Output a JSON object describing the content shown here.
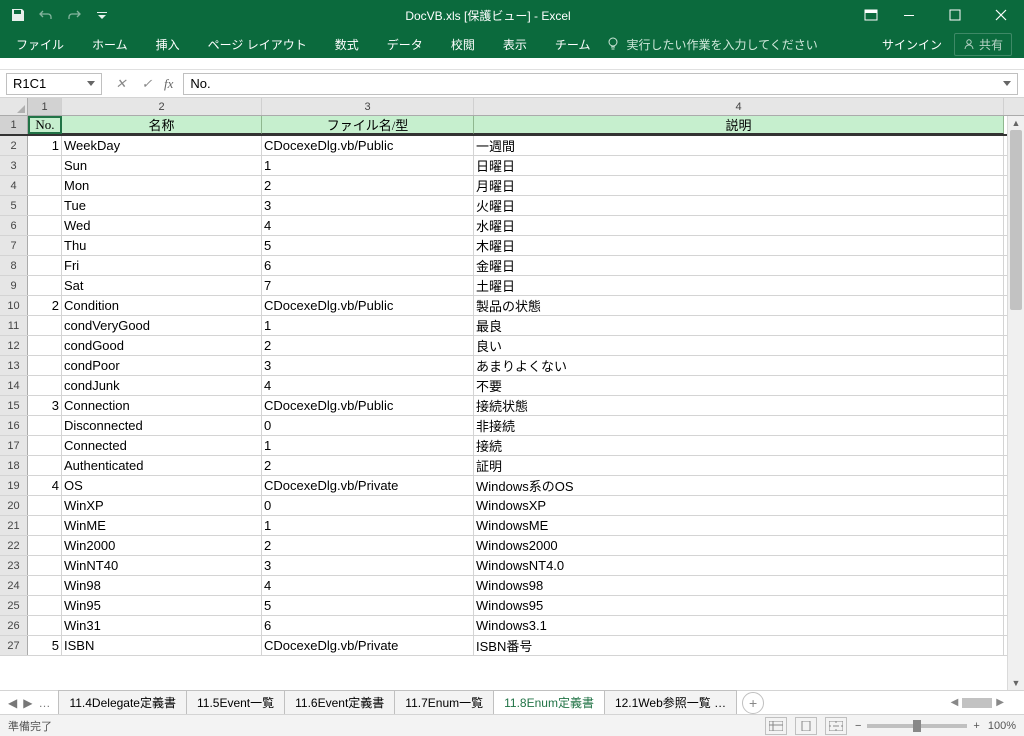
{
  "title": "DocVB.xls  [保護ビュー] - Excel",
  "ribbon_tabs": [
    "ファイル",
    "ホーム",
    "挿入",
    "ページ レイアウト",
    "数式",
    "データ",
    "校閲",
    "表示",
    "チーム"
  ],
  "tellme": "実行したい作業を入力してください",
  "signin": "サインイン",
  "share": "共有",
  "namebox": "R1C1",
  "formula": "No.",
  "col_headers": [
    "1",
    "2",
    "3",
    "4"
  ],
  "table_headers": [
    "No.",
    "名称",
    "ファイル名/型",
    "説明"
  ],
  "rows": [
    {
      "n": "1",
      "name": "WeekDay",
      "file": "CDocexeDlg.vb/Public",
      "desc": "一週間"
    },
    {
      "n": "",
      "name": "Sun",
      "file": "1",
      "desc": "日曜日"
    },
    {
      "n": "",
      "name": "Mon",
      "file": "2",
      "desc": "月曜日"
    },
    {
      "n": "",
      "name": "Tue",
      "file": "3",
      "desc": "火曜日"
    },
    {
      "n": "",
      "name": "Wed",
      "file": "4",
      "desc": "水曜日"
    },
    {
      "n": "",
      "name": "Thu",
      "file": "5",
      "desc": "木曜日"
    },
    {
      "n": "",
      "name": "Fri",
      "file": "6",
      "desc": "金曜日"
    },
    {
      "n": "",
      "name": "Sat",
      "file": "7",
      "desc": "土曜日"
    },
    {
      "n": "2",
      "name": "Condition",
      "file": "CDocexeDlg.vb/Public",
      "desc": "製品の状態"
    },
    {
      "n": "",
      "name": "condVeryGood",
      "file": "1",
      "desc": "最良"
    },
    {
      "n": "",
      "name": "condGood",
      "file": "2",
      "desc": "良い"
    },
    {
      "n": "",
      "name": "condPoor",
      "file": "3",
      "desc": "あまりよくない"
    },
    {
      "n": "",
      "name": "condJunk",
      "file": "4",
      "desc": "不要"
    },
    {
      "n": "3",
      "name": "Connection",
      "file": "CDocexeDlg.vb/Public",
      "desc": "接続状態"
    },
    {
      "n": "",
      "name": "Disconnected",
      "file": "0",
      "desc": "非接続"
    },
    {
      "n": "",
      "name": "Connected",
      "file": "1",
      "desc": "接続"
    },
    {
      "n": "",
      "name": "Authenticated",
      "file": "2",
      "desc": "証明"
    },
    {
      "n": "4",
      "name": "OS",
      "file": "CDocexeDlg.vb/Private",
      "desc": "Windows系のOS"
    },
    {
      "n": "",
      "name": "WinXP",
      "file": "0",
      "desc": "WindowsXP"
    },
    {
      "n": "",
      "name": "WinME",
      "file": "1",
      "desc": "WindowsME"
    },
    {
      "n": "",
      "name": "Win2000",
      "file": "2",
      "desc": "Windows2000"
    },
    {
      "n": "",
      "name": "WinNT40",
      "file": "3",
      "desc": "WindowsNT4.0"
    },
    {
      "n": "",
      "name": "Win98",
      "file": "4",
      "desc": "Windows98"
    },
    {
      "n": "",
      "name": "Win95",
      "file": "5",
      "desc": "Windows95"
    },
    {
      "n": "",
      "name": "Win31",
      "file": "6",
      "desc": "Windows3.1"
    },
    {
      "n": "5",
      "name": "ISBN",
      "file": "CDocexeDlg.vb/Private",
      "desc": "ISBN番号"
    }
  ],
  "sheet_nav_more": "…",
  "sheet_tabs": [
    "11.4Delegate定義書",
    "11.5Event一覧",
    "11.6Event定義書",
    "11.7Enum一覧",
    "11.8Enum定義書",
    "12.1Web参照一覧 …"
  ],
  "active_sheet_index": 4,
  "status": "準備完了",
  "zoom": "100%"
}
